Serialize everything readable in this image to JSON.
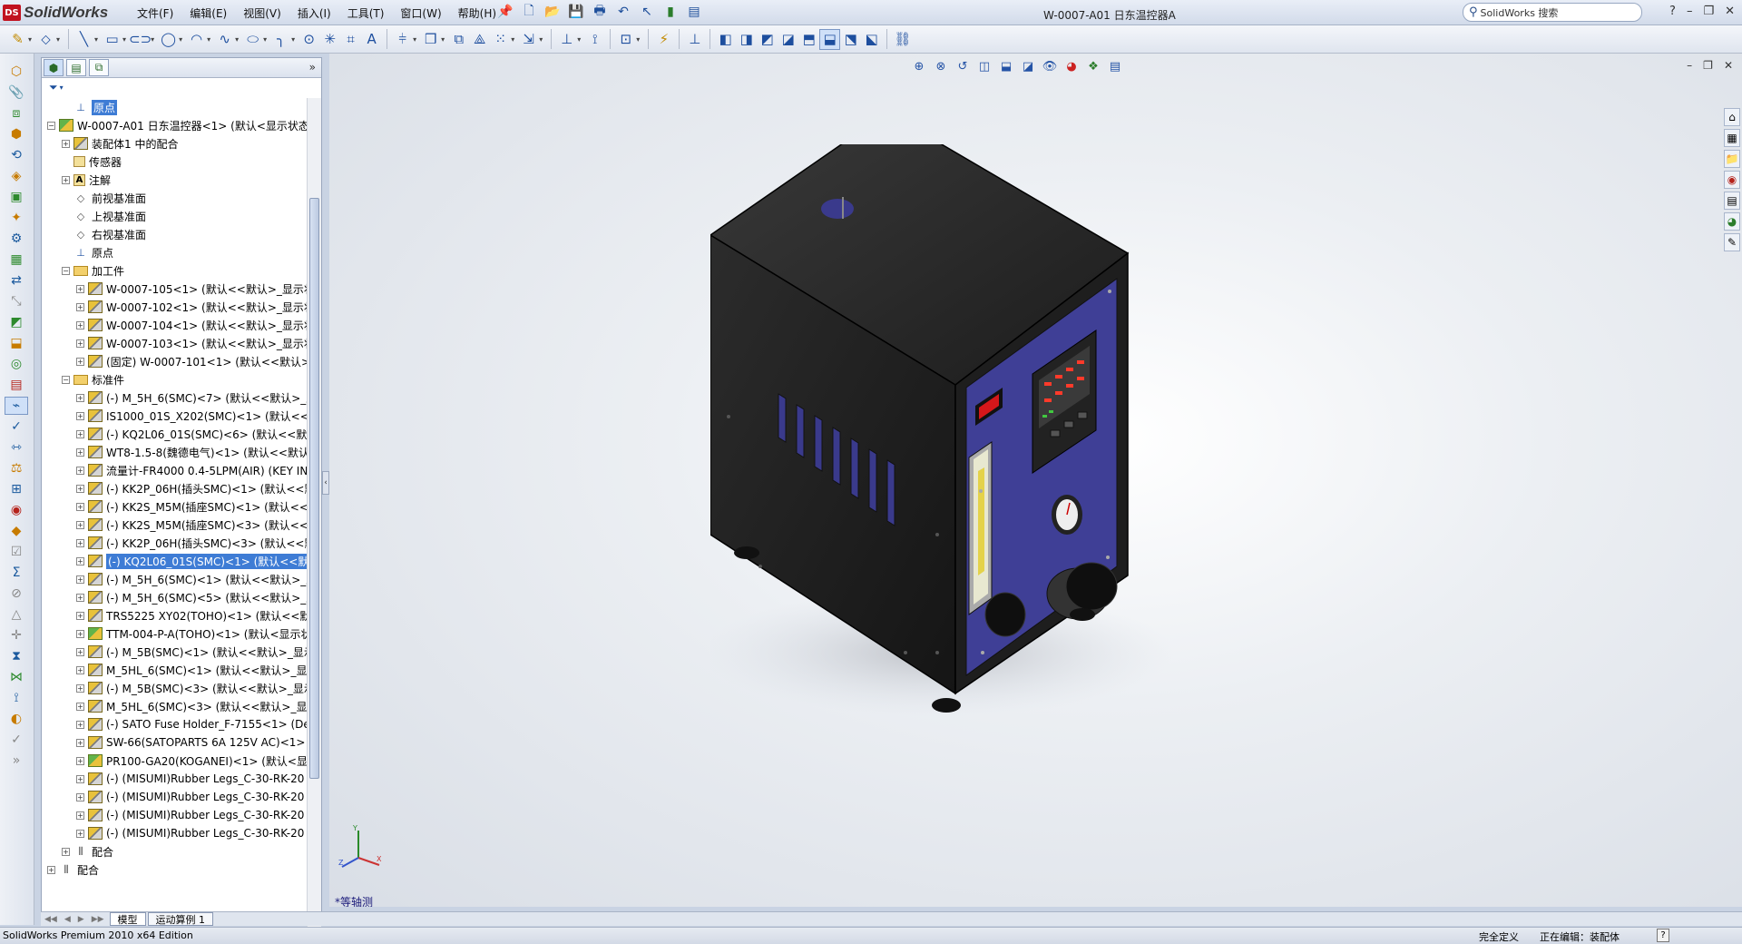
{
  "app": {
    "logo_text": "SolidWorks",
    "logo_mark": "DS",
    "doc_title": "W-0007-A01 日东温控器A",
    "search_placeholder": "SolidWorks 搜索"
  },
  "menu": [
    "文件(F)",
    "编辑(E)",
    "视图(V)",
    "插入(I)",
    "工具(T)",
    "窗口(W)",
    "帮助(H)"
  ],
  "fm_tree": [
    {
      "level": 1,
      "icon": "origin",
      "label": "原点",
      "expand": "",
      "state": "hl"
    },
    {
      "level": 0,
      "icon": "asm",
      "label": "W-0007-A01 日东温控器<1> (默认<显示状态-",
      "expand": "−"
    },
    {
      "level": 1,
      "icon": "part",
      "label": "装配体1 中的配合",
      "expand": "+"
    },
    {
      "level": 1,
      "icon": "sensor",
      "label": "传感器",
      "expand": ""
    },
    {
      "level": 1,
      "icon": "annot",
      "label": "注解",
      "expand": "+"
    },
    {
      "level": 1,
      "icon": "plane",
      "label": "前视基准面",
      "expand": ""
    },
    {
      "level": 1,
      "icon": "plane",
      "label": "上视基准面",
      "expand": ""
    },
    {
      "level": 1,
      "icon": "plane",
      "label": "右视基准面",
      "expand": ""
    },
    {
      "level": 1,
      "icon": "origin",
      "label": "原点",
      "expand": ""
    },
    {
      "level": 1,
      "icon": "folder",
      "label": "加工件",
      "expand": "−"
    },
    {
      "level": 2,
      "icon": "part",
      "label": "W-0007-105<1> (默认<<默认>_显示状",
      "expand": "+"
    },
    {
      "level": 2,
      "icon": "part",
      "label": "W-0007-102<1> (默认<<默认>_显示状",
      "expand": "+"
    },
    {
      "level": 2,
      "icon": "part",
      "label": "W-0007-104<1> (默认<<默认>_显示状",
      "expand": "+"
    },
    {
      "level": 2,
      "icon": "part",
      "label": "W-0007-103<1> (默认<<默认>_显示状",
      "expand": "+"
    },
    {
      "level": 2,
      "icon": "part",
      "label": "(固定) W-0007-101<1> (默认<<默认>",
      "expand": "+"
    },
    {
      "level": 1,
      "icon": "folder",
      "label": "标准件",
      "expand": "−"
    },
    {
      "level": 2,
      "icon": "part",
      "label": "(-) M_5H_6(SMC)<7> (默认<<默认>_显",
      "expand": "+"
    },
    {
      "level": 2,
      "icon": "part",
      "label": "IS1000_01S_X202(SMC)<1> (默认<<默",
      "expand": "+"
    },
    {
      "level": 2,
      "icon": "part",
      "label": "(-) KQ2L06_01S(SMC)<6> (默认<<默认",
      "expand": "+"
    },
    {
      "level": 2,
      "icon": "part",
      "label": "WT8-1.5-8(魏德电气)<1> (默认<<默认",
      "expand": "+"
    },
    {
      "level": 2,
      "icon": "part",
      "label": "流量计-FR4000 0.4-5LPM(AIR) (KEY IN",
      "expand": "+"
    },
    {
      "level": 2,
      "icon": "part",
      "label": "(-) KK2P_06H(插头SMC)<1> (默认<<默",
      "expand": "+"
    },
    {
      "level": 2,
      "icon": "part",
      "label": "(-) KK2S_M5M(插座SMC)<1> (默认<<",
      "expand": "+"
    },
    {
      "level": 2,
      "icon": "part",
      "label": "(-) KK2S_M5M(插座SMC)<3> (默认<<",
      "expand": "+"
    },
    {
      "level": 2,
      "icon": "part",
      "label": "(-) KK2P_06H(插头SMC)<3> (默认<<默",
      "expand": "+"
    },
    {
      "level": 2,
      "icon": "part",
      "label": "(-) KQ2L06_01S(SMC)<1> (默认<<默认",
      "expand": "+",
      "state": "sel"
    },
    {
      "level": 2,
      "icon": "part",
      "label": "(-) M_5H_6(SMC)<1> (默认<<默认>_显",
      "expand": "+"
    },
    {
      "level": 2,
      "icon": "part",
      "label": "(-) M_5H_6(SMC)<5> (默认<<默认>_显",
      "expand": "+"
    },
    {
      "level": 2,
      "icon": "part",
      "label": "TRS5225 XY02(TOHO)<1> (默认<<默认",
      "expand": "+"
    },
    {
      "level": 2,
      "icon": "asm",
      "label": "TTM-004-P-A(TOHO)<1> (默认<显示状",
      "expand": "+"
    },
    {
      "level": 2,
      "icon": "part",
      "label": "(-) M_5B(SMC)<1> (默认<<默认>_显示",
      "expand": "+"
    },
    {
      "level": 2,
      "icon": "part",
      "label": "M_5HL_6(SMC)<1> (默认<<默认>_显示",
      "expand": "+"
    },
    {
      "level": 2,
      "icon": "part",
      "label": "(-) M_5B(SMC)<3> (默认<<默认>_显示",
      "expand": "+"
    },
    {
      "level": 2,
      "icon": "part",
      "label": "M_5HL_6(SMC)<3> (默认<<默认>_显示",
      "expand": "+"
    },
    {
      "level": 2,
      "icon": "part",
      "label": "(-) SATO Fuse Holder_F-7155<1> (De",
      "expand": "+"
    },
    {
      "level": 2,
      "icon": "part",
      "label": "SW-66(SATOPARTS 6A 125V AC)<1> (",
      "expand": "+"
    },
    {
      "level": 2,
      "icon": "asm",
      "label": "PR100-GA20(KOGANEI)<1> (默认<显",
      "expand": "+"
    },
    {
      "level": 2,
      "icon": "part",
      "label": "(-) (MISUMI)Rubber Legs_C-30-RK-20",
      "expand": "+"
    },
    {
      "level": 2,
      "icon": "part",
      "label": "(-) (MISUMI)Rubber Legs_C-30-RK-20",
      "expand": "+"
    },
    {
      "level": 2,
      "icon": "part",
      "label": "(-) (MISUMI)Rubber Legs_C-30-RK-20",
      "expand": "+"
    },
    {
      "level": 2,
      "icon": "part",
      "label": "(-) (MISUMI)Rubber Legs_C-30-RK-20",
      "expand": "+"
    },
    {
      "level": 1,
      "icon": "mates",
      "label": "配合",
      "expand": "+"
    },
    {
      "level": 0,
      "icon": "mates",
      "label": "配合",
      "expand": "+"
    }
  ],
  "bottom_tabs": [
    "模型",
    "运动算例 1"
  ],
  "view_label": "*等轴测",
  "status": {
    "edition": "SolidWorks Premium 2010 x64 Edition",
    "definition": "完全定义",
    "editing": "正在编辑：装配体",
    "help": "?"
  },
  "colors": {
    "accent_select": "#3e7cd5",
    "panel_blue": "#3a3a8c",
    "box_black": "#1f1f1f"
  }
}
